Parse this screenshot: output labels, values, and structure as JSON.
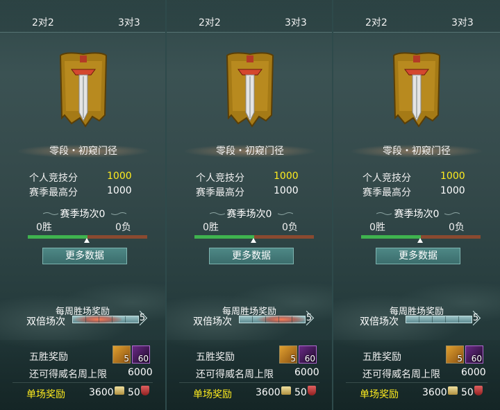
{
  "tabs": {
    "two_v_two": "2对2",
    "three_v_three": "3对3"
  },
  "rank": {
    "title": "零段・初窥门径"
  },
  "stats": {
    "personal_score_label": "个人竞技分",
    "personal_score_value": "1000",
    "season_best_label": "赛季最高分",
    "season_best_value": "1000"
  },
  "season": {
    "matches_label": "赛季场次0",
    "wins": "0胜",
    "losses": "0负",
    "win_ratio": 0.5
  },
  "more_data_button": "更多数据",
  "weekly": {
    "title": "每周胜场奖励",
    "double_label": "双倍场次",
    "double_count": "5"
  },
  "rewards": {
    "five_win_label": "五胜奖励",
    "item1_count": "5",
    "item2_count": "60",
    "remaining_label": "还可得威名周上限",
    "remaining_value": "6000",
    "single_label": "单场奖励",
    "single_coin_value": "3600",
    "single_shield_value": "50"
  },
  "colors": {
    "highlight_yellow": "#ffec1e",
    "win_green": "#3fb34f",
    "loss_brown": "#8a4a30",
    "button_teal": "#3b6d6c"
  }
}
